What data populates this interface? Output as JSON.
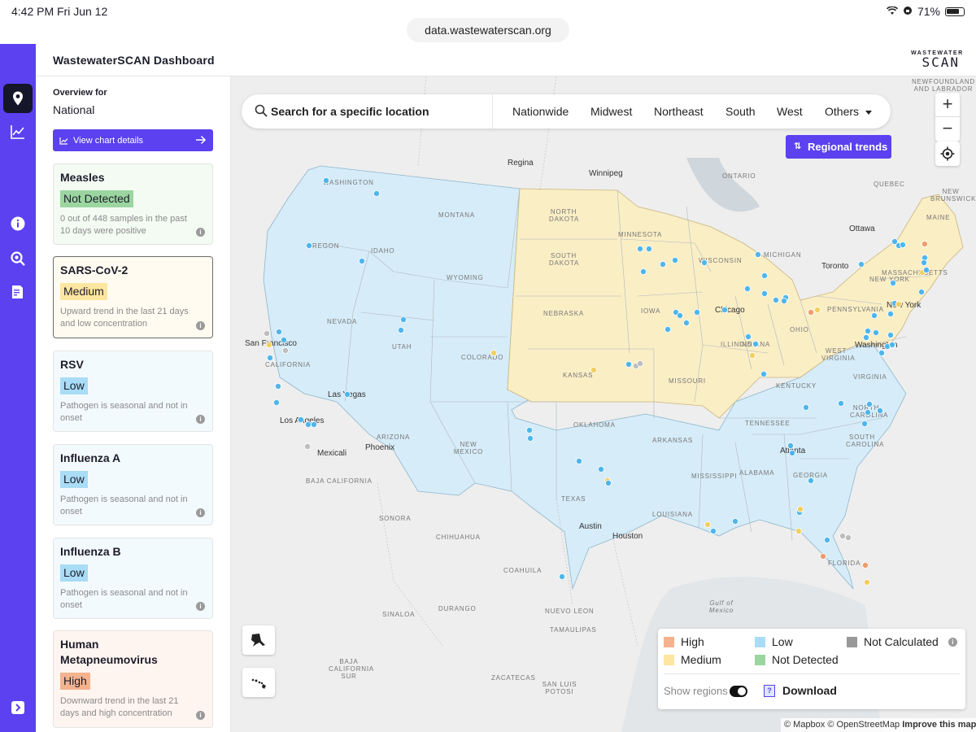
{
  "status": {
    "time": "4:42 PM",
    "date": "Fri Jun 12",
    "battery": "71%"
  },
  "browser": {
    "url": "data.wastewaterscan.org"
  },
  "header": {
    "title": "WastewaterSCAN Dashboard",
    "logo_top": "WASTEWATER",
    "logo_bottom": "SCAN"
  },
  "overview": {
    "label": "Overview for",
    "value": "National",
    "chart_button": "View chart details"
  },
  "cards": [
    {
      "name": "Measles",
      "level": "Not Detected",
      "desc": "0 out of 448 samples in the past 10 days were positive"
    },
    {
      "name": "SARS-CoV-2",
      "level": "Medium",
      "desc": "Upward trend in the last 21 days and low concentration"
    },
    {
      "name": "RSV",
      "level": "Low",
      "desc": "Pathogen is seasonal and not in onset"
    },
    {
      "name": "Influenza A",
      "level": "Low",
      "desc": "Pathogen is seasonal and not in onset"
    },
    {
      "name": "Influenza B",
      "level": "Low",
      "desc": "Pathogen is seasonal and not in onset"
    },
    {
      "name": "Human Metapneumovirus",
      "level": "High",
      "desc": "Downward trend in the last 21 days and high concentration"
    }
  ],
  "colors": {
    "accent": "#5b41f0",
    "high": "#f3b38f",
    "medium": "#fde6a0",
    "low": "#a9dcf6",
    "not_detected": "#9bd6a0",
    "not_calculated": "#999999",
    "region_low": "#d6ecf8",
    "region_medium": "#faeec5"
  },
  "search": {
    "placeholder": "Search for a specific location"
  },
  "regions": [
    "Nationwide",
    "Midwest",
    "Northeast",
    "South",
    "West"
  ],
  "others": "Others",
  "regional_trends": "Regional trends",
  "legend": {
    "high": "High",
    "medium": "Medium",
    "low": "Low",
    "not_detected": "Not Detected",
    "not_calculated": "Not Calculated",
    "show_regions": "Show regions",
    "download": "Download"
  },
  "map_labels": {
    "states": [
      "WASHINGTON",
      "MONTANA",
      "OREGON",
      "IDAHO",
      "WYOMING",
      "NEVADA",
      "UTAH",
      "COLORADO",
      "CALIFORNIA",
      "ARIZONA",
      "NEW MEXICO",
      "NORTH DAKOTA",
      "SOUTH DAKOTA",
      "NEBRASKA",
      "KANSAS",
      "OKLAHOMA",
      "TEXAS",
      "MINNESOTA",
      "IOWA",
      "MISSOURI",
      "ARKANSAS",
      "LOUISIANA",
      "WISCONSIN",
      "ILLINOIS",
      "MICHIGAN",
      "INDIANA",
      "OHIO",
      "KENTUCKY",
      "TENNESSEE",
      "MISSISSIPPI",
      "ALABAMA",
      "GEORGIA",
      "FLORIDA",
      "SOUTH CAROLINA",
      "NORTH CAROLINA",
      "VIRGINIA",
      "WEST VIRGINIA",
      "PENNSYLVANIA",
      "NEW YORK",
      "MASSACHUSETTS",
      "MAINE",
      "NEW BRUNSWICK",
      "NEWFOUNDLAND AND LABRADOR",
      "ONTARIO",
      "QUEBEC",
      "SONORA",
      "CHIHUAHUA",
      "COAHUILA",
      "NUEVO LEON",
      "DURANGO",
      "SINALOA",
      "TAMAULIPAS",
      "ZACATECAS",
      "SAN LUIS POTOSI",
      "BAJA CALIFORNIA SUR",
      "BAJA CALIFORNIA",
      "Gulf of Mexico"
    ],
    "cities": [
      "Regina",
      "Winnipeg",
      "Ottawa",
      "Toronto",
      "Chicago",
      "New York",
      "Washington",
      "San Francisco",
      "Las Vegas",
      "Los Angeles",
      "Phoenix",
      "Mexicali",
      "Austin",
      "Houston",
      "Atlanta"
    ]
  },
  "attribution": {
    "mapbox": "© Mapbox",
    "osm": "© OpenStreetMap",
    "improve": "Improve this map"
  }
}
